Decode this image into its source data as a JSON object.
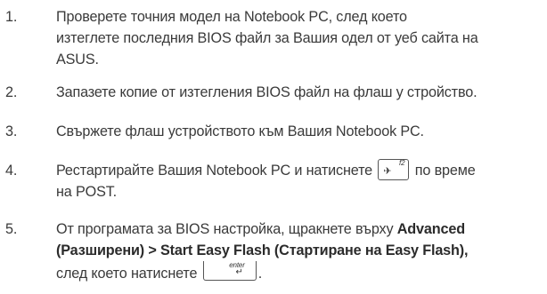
{
  "steps": [
    {
      "number": "1.",
      "lines": [
        "Проверете точния модел на Notebook PC, след което",
        "изтеглете последния BIOS файл за Вашия одел от уеб сайта на",
        "ASUS."
      ]
    },
    {
      "number": "2.",
      "lines": [
        "Запазете копие от изтегления BIOS файл на флаш у стройство."
      ]
    },
    {
      "number": "3.",
      "lines": [
        "Свържете флаш устройството към Вашия Notebook PC."
      ]
    },
    {
      "number": "4.",
      "line1_before": "Рестартирайте Вашия Notebook PC и натиснете",
      "line1_after": "по време",
      "line2": "на POST."
    },
    {
      "number": "5.",
      "line1_before": "От програмата за BIOS настройка, щракнете върху",
      "line1_bold": "Advanced",
      "line2_bold": "(Разширени) > Start Easy Flash (Стартиране на Easy Flash),",
      "line3_before": "след което натиснете",
      "line3_after": "."
    }
  ],
  "keys": {
    "f2": {
      "label": "f2",
      "icon": "airplane-icon",
      "glyph": "✈"
    },
    "enter": {
      "label": "enter",
      "icon": "enter-arrow-icon",
      "glyph": "↵"
    }
  }
}
